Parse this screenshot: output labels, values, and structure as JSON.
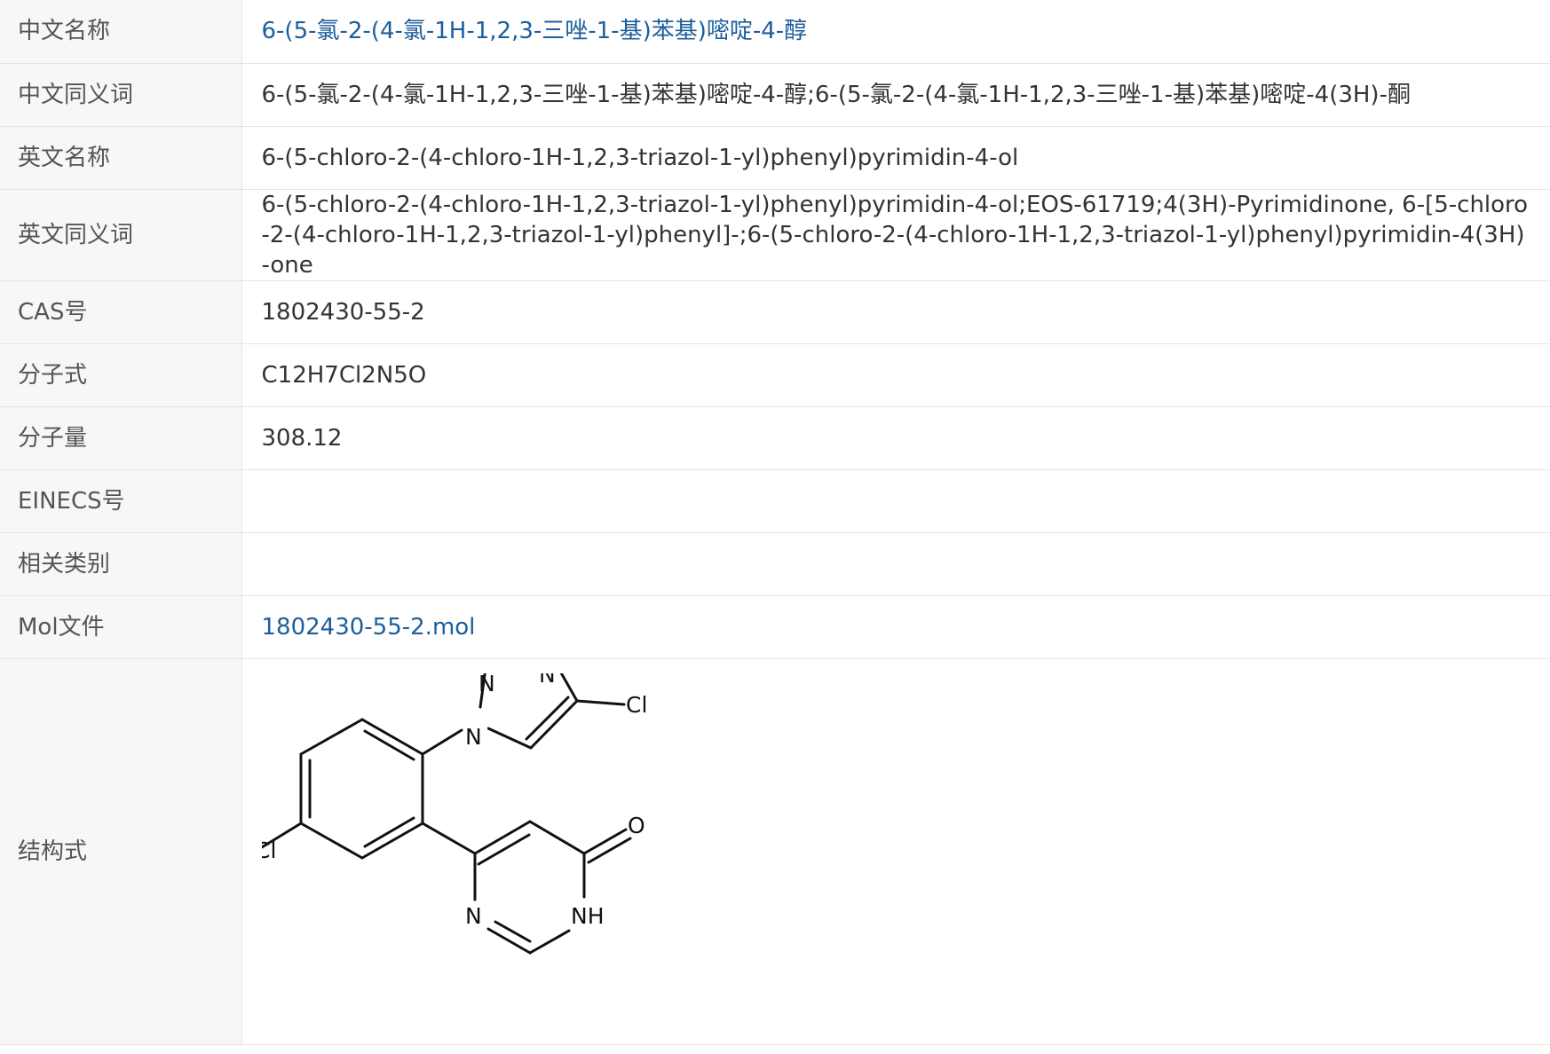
{
  "rows": [
    {
      "label": "中文名称",
      "value": "6-(5-氯-2-(4-氯-1H-1,2,3-三唑-1-基)苯基)嘧啶-4-醇"
    },
    {
      "label": "中文同义词",
      "value": "6-(5-氯-2-(4-氯-1H-1,2,3-三唑-1-基)苯基)嘧啶-4-醇;6-(5-氯-2-(4-氯-1H-1,2,3-三唑-1-基)苯基)嘧啶-4(3H)-酮"
    },
    {
      "label": "英文名称",
      "value": "6-(5-chloro-2-(4-chloro-1H-1,2,3-triazol-1-yl)phenyl)pyrimidin-4-ol"
    },
    {
      "label": "英文同义词",
      "value": "6-(5-chloro-2-(4-chloro-1H-1,2,3-triazol-1-yl)phenyl)pyrimidin-4-ol;EOS-61719;4(3H)-Pyrimidinone, 6-[5-chloro-2-(4-chloro-1H-1,2,3-triazol-1-yl)phenyl]-;6-(5-chloro-2-(4-chloro-1H-1,2,3-triazol-1-yl)phenyl)pyrimidin-4(3H)-one"
    },
    {
      "label": "CAS号",
      "value": "1802430-55-2"
    },
    {
      "label": "分子式",
      "value": "C12H7Cl2N5O"
    },
    {
      "label": "分子量",
      "value": "308.12"
    },
    {
      "label": "EINECS号",
      "value": ""
    },
    {
      "label": "相关类别",
      "value": ""
    },
    {
      "label": "Mol文件",
      "value": "1802430-55-2.mol"
    },
    {
      "label": "结构式",
      "value": ""
    }
  ],
  "structure": {
    "atom_labels": {
      "n_top_left": "N",
      "n_top_right": "N",
      "n_1": "N",
      "cl_triazole": "Cl",
      "cl_phenyl": "Cl",
      "o": "O",
      "n_pyrimidine": "N",
      "nh": "NH"
    }
  },
  "colors": {
    "link": "#1c5e9c",
    "label_bg": "#f7f7f7",
    "border": "#e4e4e4"
  }
}
